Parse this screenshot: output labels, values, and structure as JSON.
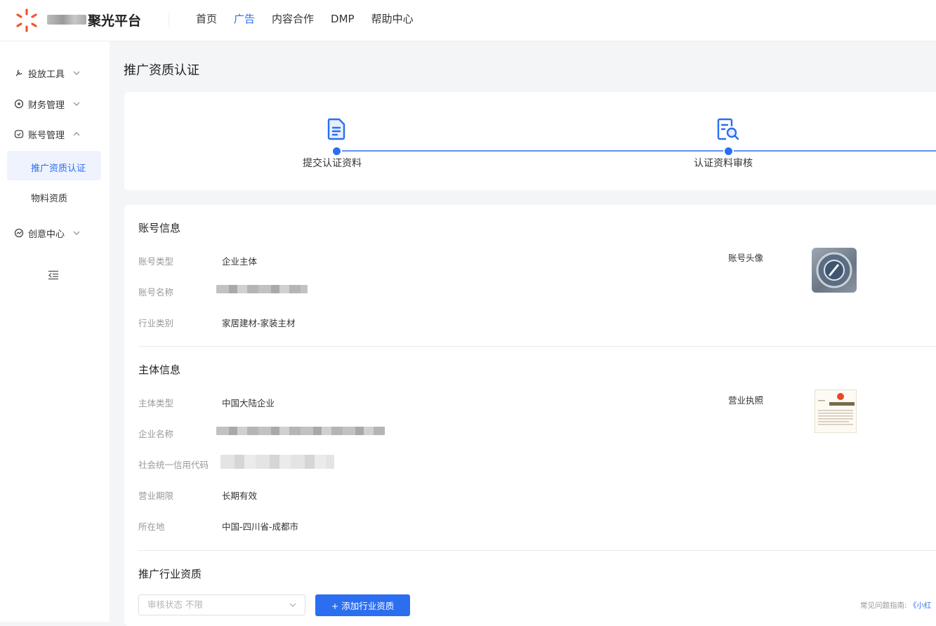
{
  "header": {
    "platform_name": "聚光平台",
    "nav": [
      {
        "label": "首页",
        "active": false
      },
      {
        "label": "广告",
        "active": true
      },
      {
        "label": "内容合作",
        "active": false
      },
      {
        "label": "DMP",
        "active": false
      },
      {
        "label": "帮助中心",
        "active": false
      }
    ]
  },
  "sidebar": {
    "items": [
      {
        "label": "投放工具",
        "icon": "tool-icon",
        "expanded": false
      },
      {
        "label": "财务管理",
        "icon": "finance-icon",
        "expanded": false
      },
      {
        "label": "账号管理",
        "icon": "account-icon",
        "expanded": true
      },
      {
        "label": "创意中心",
        "icon": "creative-icon",
        "expanded": false
      }
    ],
    "subitems": [
      {
        "label": "推广资质认证",
        "active": true
      },
      {
        "label": "物料资质",
        "active": false
      }
    ]
  },
  "page": {
    "title": "推广资质认证"
  },
  "steps": [
    {
      "label": "提交认证资料",
      "icon": "document-icon"
    },
    {
      "label": "认证资料审核",
      "icon": "document-search-icon"
    }
  ],
  "account_info": {
    "title": "账号信息",
    "type_label": "账号类型",
    "type_value": "企业主体",
    "name_label": "账号名称",
    "industry_label": "行业类别",
    "industry_value": "家居建材-家装主材",
    "avatar_label": "账号头像"
  },
  "subject_info": {
    "title": "主体信息",
    "type_label": "主体类型",
    "type_value": "中国大陆企业",
    "company_label": "企业名称",
    "credit_label": "社会统一信用代码",
    "period_label": "营业期限",
    "period_value": "长期有效",
    "location_label": "所在地",
    "location_value": "中国-四川省-成都市",
    "license_label": "营业执照"
  },
  "industry_qual": {
    "title": "推广行业资质",
    "filter_placeholder": "审核状态 不限",
    "add_button": "+ 添加行业资质",
    "faq_prefix": "常见问题指南:",
    "faq_link": "《小红"
  },
  "colors": {
    "accent": "#2b6ef0",
    "logo": "#f2552c"
  }
}
